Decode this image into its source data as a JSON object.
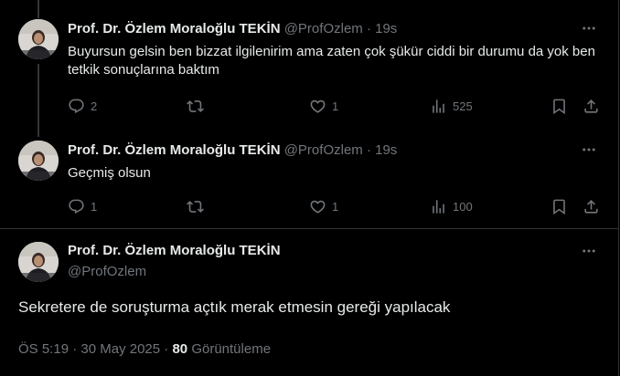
{
  "colors": {
    "background": "#000000",
    "text_primary": "#e7e9ea",
    "text_secondary": "#71767b",
    "border": "#2f3336"
  },
  "replies": [
    {
      "author_name": "Prof. Dr. Özlem Moraloğlu TEKİN",
      "handle": "@ProfOzlem",
      "separator": "·",
      "time": "19s",
      "text": "Buyursun gelsin ben bizzat ilgilenirim ama zaten çok şükür ciddi bir durumu da yok ben tetkik sonuçlarına baktım",
      "reply_count": "2",
      "repost_count": "",
      "like_count": "1",
      "view_count": "525"
    },
    {
      "author_name": "Prof. Dr. Özlem Moraloğlu TEKİN",
      "handle": "@ProfOzlem",
      "separator": "·",
      "time": "19s",
      "text": "Geçmiş olsun",
      "reply_count": "1",
      "repost_count": "",
      "like_count": "1",
      "view_count": "100"
    }
  ],
  "main_post": {
    "author_name": "Prof. Dr. Özlem Moraloğlu TEKİN",
    "handle": "@ProfOzlem",
    "text": "Sekretere de soruşturma açtık merak etmesin gereği yapılacak",
    "time": "ÖS 5:19",
    "separator": "·",
    "date": "30 May 2025",
    "views_count": "80",
    "views_label": "Görüntüleme"
  },
  "icons": {
    "reply": "reply-icon",
    "repost": "repost-icon",
    "like": "like-icon",
    "views": "views-icon",
    "bookmark": "bookmark-icon",
    "share": "share-icon",
    "more": "more-icon"
  }
}
